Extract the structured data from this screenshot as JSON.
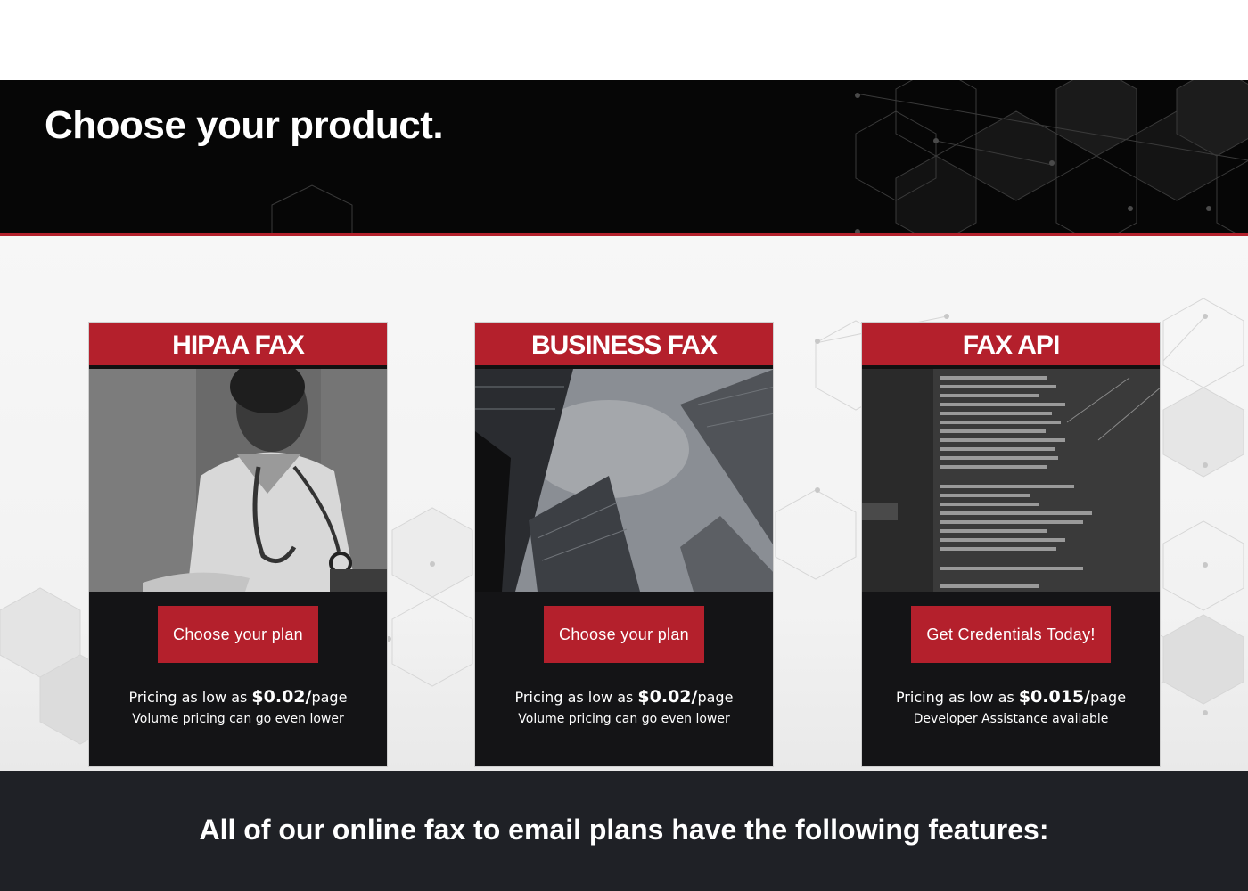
{
  "hero": {
    "title": "Choose your product."
  },
  "cards": [
    {
      "title": "HIPAA FAX",
      "button": "Choose your plan",
      "price_prefix": "Pricing as low as ",
      "price_value": "$0.02/",
      "price_suffix": "page",
      "note": "Volume pricing can go even lower",
      "image": "nurse-with-stethoscope-photo"
    },
    {
      "title": "BUSINESS FAX",
      "button": "Choose your plan",
      "price_prefix": "Pricing as low as ",
      "price_value": "$0.02/",
      "price_suffix": "page",
      "note": "Volume pricing can go even lower",
      "image": "skyscrapers-photo"
    },
    {
      "title": "FAX API",
      "button": "Get Credentials Today!",
      "price_prefix": "Pricing as low as ",
      "price_value": "$0.015/",
      "price_suffix": "page",
      "note": "Developer Assistance available",
      "image": "code-screen-photo"
    }
  ],
  "features": {
    "title": "All of our online fax to email plans have the following features:"
  },
  "colors": {
    "accent": "#b4202c",
    "hero_bg": "#060606",
    "card_bg": "#141416",
    "footer_bg": "#1f2126"
  }
}
